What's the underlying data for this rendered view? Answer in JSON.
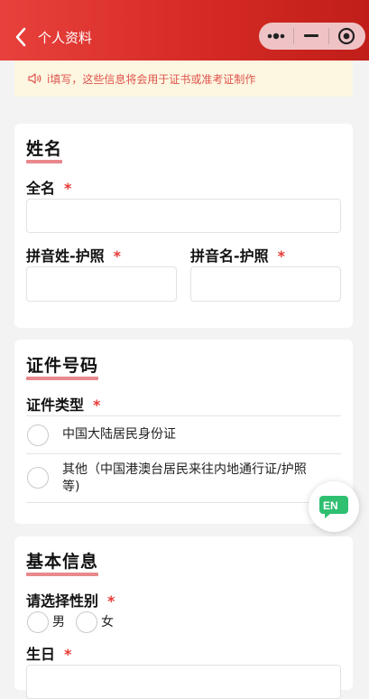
{
  "header": {
    "title": "个人资料"
  },
  "notice": {
    "text": "i填写，这些信息将会用于证书或准考证制作"
  },
  "sections": {
    "name": {
      "title": "姓名",
      "full_name_label": "全名",
      "pinyin_surname_label": "拼音姓-护照",
      "pinyin_given_label": "拼音名-护照",
      "required_mark": "*"
    },
    "id": {
      "title": "证件号码",
      "type_label": "证件类型",
      "required_mark": "*",
      "options": [
        "中国大陆居民身份证",
        "其他（中国港澳台居民来往内地通行证/护照",
        "等)"
      ]
    },
    "basic": {
      "title": "基本信息",
      "gender_label": "请选择性别",
      "required_mark": "*",
      "gender_options": [
        "男",
        "女"
      ],
      "birthday_label": "生日"
    }
  },
  "floating": {
    "lang_label": "EN"
  },
  "colors": {
    "header_red": "#d52a24",
    "required_red": "#e63a35",
    "title_underline": "#e8898d",
    "notice_bg": "#fdf7e1",
    "en_green": "#2fbf71"
  }
}
